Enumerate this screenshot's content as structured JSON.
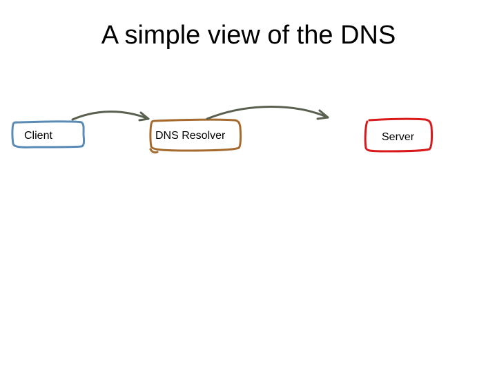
{
  "title": "A simple view of the DNS",
  "nodes": {
    "client": {
      "label": "Client",
      "color": "#5a8bb5"
    },
    "resolver": {
      "label": "DNS Resolver",
      "color": "#a56b2e"
    },
    "server": {
      "label": "Server",
      "color": "#d91a1a"
    }
  },
  "arrows": {
    "color": "#5a6050",
    "edges": [
      "client-to-resolver",
      "resolver-to-server"
    ]
  }
}
